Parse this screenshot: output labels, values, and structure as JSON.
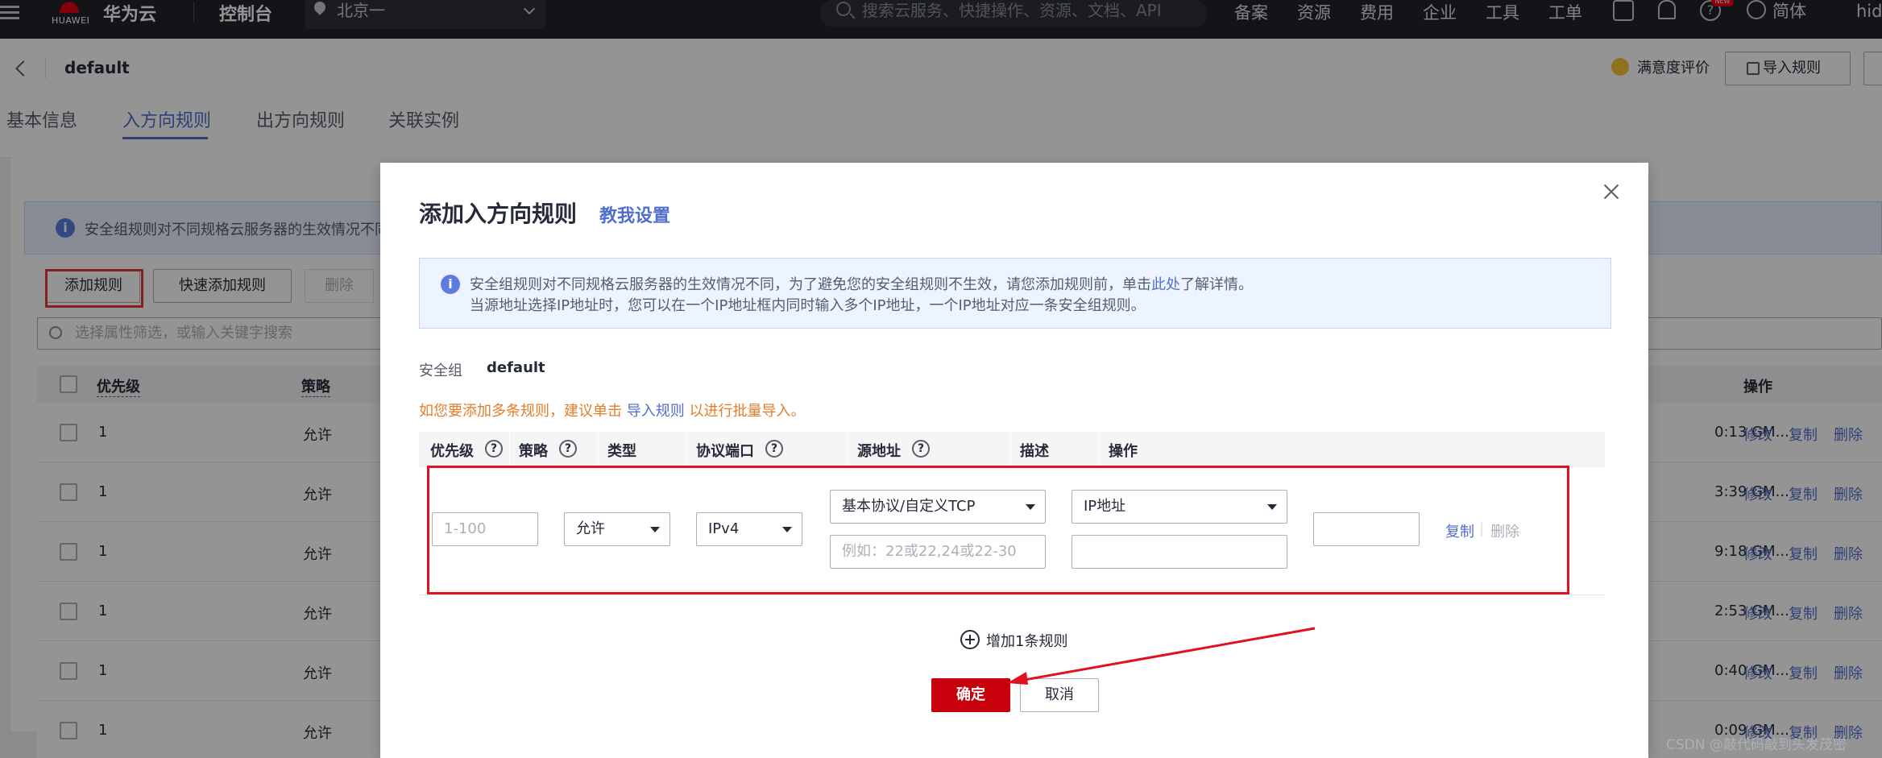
{
  "topbar": {
    "brand_sub": "HUAWEI",
    "brand": "华为云",
    "console": "控制台",
    "region": "北京一",
    "search_placeholder": "搜索云服务、快捷操作、资源、文档、API",
    "links": [
      "备案",
      "资源",
      "费用",
      "企业",
      "工具",
      "工单"
    ],
    "new_badge": "NEW",
    "language": "简体",
    "user": "hid"
  },
  "header": {
    "title": "default",
    "rating": "满意度评价",
    "import_button": "导入规则",
    "tabs": [
      "基本信息",
      "入方向规则",
      "出方向规则",
      "关联实例"
    ]
  },
  "background": {
    "alert": "安全组规则对不同规格云服务器的生效情况不同",
    "buttons": {
      "add": "添加规则",
      "quick_add": "快速添加规则",
      "delete": "删除"
    },
    "search_placeholder": "选择属性筛选，或输入关键字搜索",
    "columns": {
      "priority": "优先级",
      "policy": "策略",
      "actions": "操作"
    },
    "rows": [
      {
        "priority": "1",
        "policy": "允许",
        "time": "0:13 GM..."
      },
      {
        "priority": "1",
        "policy": "允许",
        "time": "3:39 GM..."
      },
      {
        "priority": "1",
        "policy": "允许",
        "time": "9:18 GM..."
      },
      {
        "priority": "1",
        "policy": "允许",
        "time": "2:53 GM..."
      },
      {
        "priority": "1",
        "policy": "允许",
        "time": "0:40 GM..."
      },
      {
        "priority": "1",
        "policy": "允许",
        "time": "0:09 GM..."
      }
    ],
    "row_actions": {
      "edit": "修改",
      "copy": "复制",
      "delete": "删除"
    }
  },
  "modal": {
    "title": "添加入方向规则",
    "help_link": "教我设置",
    "alert_line1_prefix": "安全组规则对不同规格云服务器的生效情况不同，为了避免您的安全组规则不生效，请您添加规则前，单击",
    "alert_link": "此处",
    "alert_line1_suffix": "了解详情。",
    "alert_line2": "当源地址选择IP地址时，您可以在一个IP地址框内同时输入多个IP地址，一个IP地址对应一条安全组规则。",
    "sg_label": "安全组",
    "sg_value": "default",
    "tip_prefix": "如您要添加多条规则，建议单击 ",
    "tip_link": "导入规则",
    "tip_suffix": " 以进行批量导入。",
    "columns": {
      "priority": "优先级",
      "policy": "策略",
      "type": "类型",
      "protocol_port": "协议端口",
      "source": "源地址",
      "description": "描述",
      "actions": "操作"
    },
    "row": {
      "priority_placeholder": "1-100",
      "policy": "允许",
      "type": "IPv4",
      "protocol": "基本协议/自定义TCP",
      "port_placeholder": "例如：22或22,24或22-30",
      "source_type": "IP地址",
      "source_value": "",
      "description": "",
      "copy": "复制",
      "delete": "删除"
    },
    "add_row": "增加1条规则",
    "ok": "确定",
    "cancel": "取消"
  },
  "watermark": "CSDN @敲代码敲到头发茂密",
  "colors": {
    "primary_link": "#526ecc",
    "confirm": "#c7000b",
    "annotation": "#e0121f",
    "tip": "#e37d29"
  }
}
